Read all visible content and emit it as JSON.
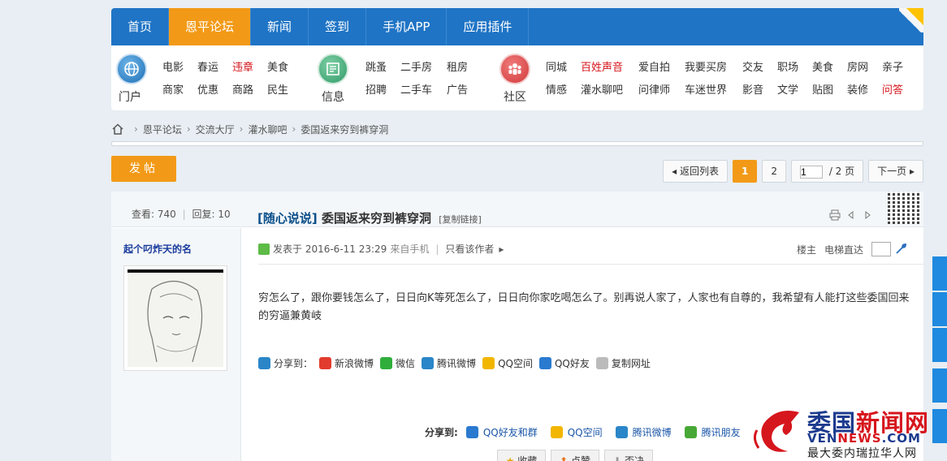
{
  "topnav": {
    "tabs": [
      {
        "label": "首页",
        "active": false
      },
      {
        "label": "恩平论坛",
        "active": true
      },
      {
        "label": "新闻",
        "active": false
      },
      {
        "label": "签到",
        "active": false
      },
      {
        "label": "手机APP",
        "active": false
      },
      {
        "label": "应用插件",
        "active": false
      }
    ]
  },
  "subnav": {
    "portal": {
      "label": "门户",
      "row1": [
        "电影",
        "春运",
        "违章",
        "美食"
      ],
      "row2": [
        "商家",
        "优惠",
        "商路",
        "民生"
      ],
      "red": [
        "违章"
      ]
    },
    "info": {
      "label": "信息",
      "row1": [
        "跳蚤",
        "二手房",
        "租房"
      ],
      "row2": [
        "招聘",
        "二手车",
        "广告"
      ]
    },
    "community": {
      "label": "社区",
      "row1": [
        "同城",
        "百姓声音",
        "爱自拍",
        "我要买房",
        "交友",
        "职场",
        "美食",
        "房网",
        "亲子"
      ],
      "row2": [
        "情感",
        "灌水聊吧",
        "问律师",
        "车迷世界",
        "影音",
        "文学",
        "贴图",
        "装修",
        "问答"
      ],
      "red": [
        "百姓声音",
        "问答"
      ]
    }
  },
  "breadcrumb": [
    "恩平论坛",
    "交流大厅",
    "灌水聊吧",
    "委国返来穷到裤穿洞"
  ],
  "post_button": "发帖",
  "pager": {
    "back": "返回列表",
    "current": "1",
    "next_page": "2",
    "input_value": "1",
    "total": "/ 2 页",
    "next": "下一页"
  },
  "thread": {
    "views_label": "查看:",
    "views": "740",
    "replies_label": "回复:",
    "replies": "10",
    "category": "[随心说说]",
    "title": "委国返来穷到裤穿洞",
    "copy_link": "[复制链接]"
  },
  "post": {
    "author": "起个叼炸天的名",
    "posted": "发表于 2016-6-11 23:29",
    "from": "来自手机",
    "only_author": "只看该作者",
    "floor": "楼主",
    "jump": "电梯直达",
    "content": "穷怎么了，跟你要钱怎么了，日日向K等死怎么了，日日向你家吃喝怎么了。别再说人家了，人家也有自尊的，我希望有人能打这些委国回来的穷逼兼黄岐",
    "share_label": "分享到：",
    "share_items": [
      {
        "label": "新浪微博",
        "color": "#e23b2e"
      },
      {
        "label": "微信",
        "color": "#2fae3b"
      },
      {
        "label": "腾讯微博",
        "color": "#2a86c8"
      },
      {
        "label": "QQ空间",
        "color": "#f2b600"
      },
      {
        "label": "QQ好友",
        "color": "#2a7ad0"
      },
      {
        "label": "复制网址",
        "color": "#bbbbbb"
      }
    ],
    "share2_label": "分享到:",
    "share2_items": [
      {
        "label": "QQ好友和群",
        "color": "#2a7ad0"
      },
      {
        "label": "QQ空间",
        "color": "#f2b600"
      },
      {
        "label": "腾讯微博",
        "color": "#2a86c8"
      },
      {
        "label": "腾讯朋友",
        "color": "#47a836"
      }
    ],
    "actions": [
      "收藏",
      "点赞",
      "否决"
    ]
  },
  "watermark": {
    "line1a": "委国",
    "line1b": "新闻网",
    "line2a": "VEN",
    "line2b": "NEWS",
    "line2c": ".COM",
    "line3": "最大委内瑞拉华人网"
  }
}
